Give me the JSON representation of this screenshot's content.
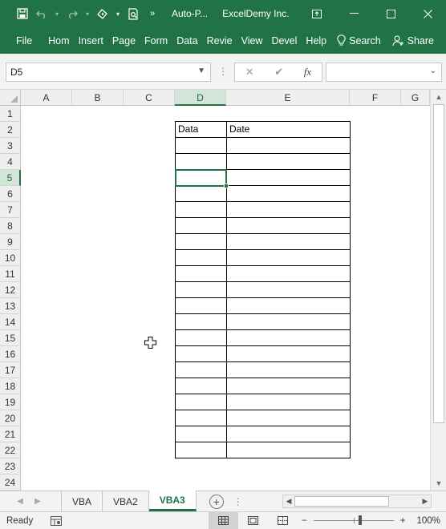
{
  "titlebar": {
    "doc_title": "Auto-P...",
    "org": "ExcelDemy Inc."
  },
  "ribbon": {
    "tabs": [
      "File",
      "Hom",
      "Insert",
      "Page",
      "Form",
      "Data",
      "Revie",
      "View",
      "Devel",
      "Help"
    ],
    "search_label": "Search",
    "share_label": "Share"
  },
  "formula_bar": {
    "name_box": "D5",
    "cancel_symbol": "✕",
    "enter_symbol": "✔",
    "fx_symbol": "fx",
    "formula_value": ""
  },
  "grid": {
    "columns": [
      "A",
      "B",
      "C",
      "D",
      "E",
      "F",
      "G"
    ],
    "selected_column": "D",
    "rows": [
      "1",
      "2",
      "3",
      "4",
      "5",
      "6",
      "7",
      "8",
      "9",
      "10",
      "11",
      "12",
      "13",
      "14",
      "15",
      "16",
      "17",
      "18",
      "19",
      "20",
      "21",
      "22",
      "23",
      "24"
    ],
    "selected_row": "5",
    "table": {
      "header_data": "Data",
      "header_date": "Date"
    }
  },
  "sheets": {
    "tabs": [
      "VBA",
      "VBA2",
      "VBA3"
    ],
    "active": "VBA3"
  },
  "status": {
    "text": "Ready",
    "zoom": "100%"
  },
  "colors": {
    "brand": "#217346",
    "table_border": "#000000"
  }
}
